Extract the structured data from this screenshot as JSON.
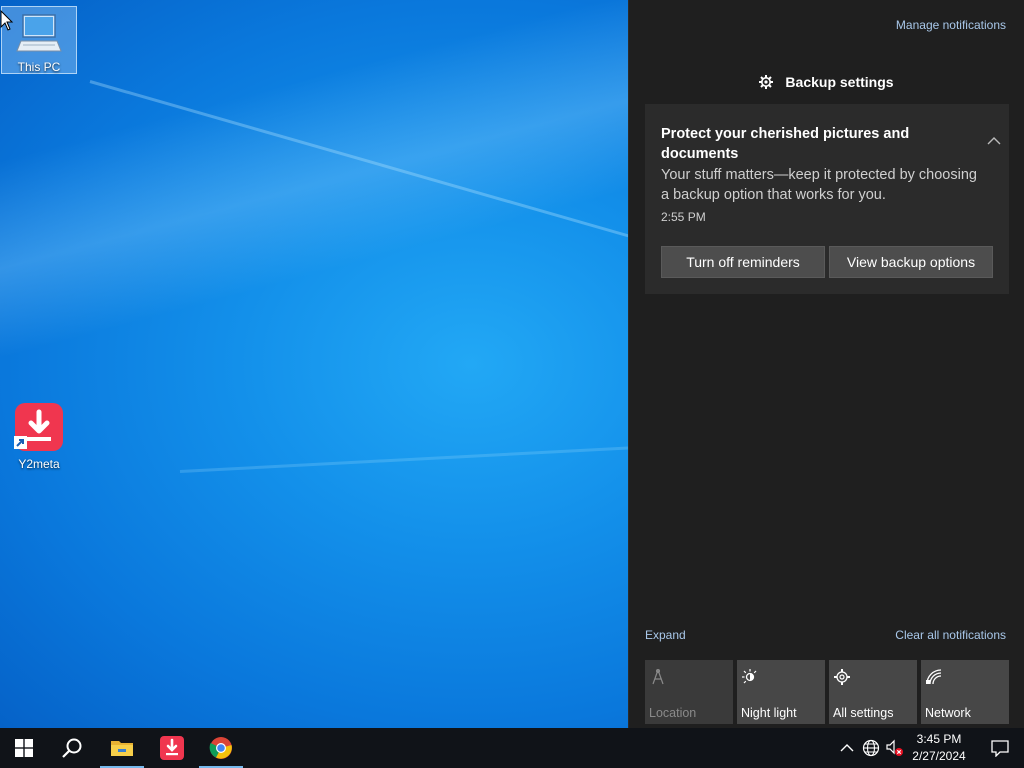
{
  "desktop": {
    "icons": [
      {
        "label": "This PC",
        "icon": "computer-icon"
      },
      {
        "label": "Y2meta",
        "icon": "y2meta-download-icon"
      }
    ]
  },
  "action_center": {
    "manage_notifications": "Manage notifications",
    "group_header": "Backup settings",
    "toast": {
      "title": "Protect your cherished pictures and documents",
      "body": "Your stuff matters—keep it protected by choosing a backup option that works for you.",
      "time": "2:55 PM",
      "buttons": [
        "Turn off reminders",
        "View backup options"
      ]
    },
    "expand": "Expand",
    "clear_all": "Clear all notifications",
    "quick_actions": [
      {
        "label": "Location",
        "icon": "location-icon",
        "enabled": false
      },
      {
        "label": "Night light",
        "icon": "night-light-icon",
        "enabled": true
      },
      {
        "label": "All settings",
        "icon": "gear-icon",
        "enabled": true
      },
      {
        "label": "Network",
        "icon": "network-icon",
        "enabled": true
      }
    ]
  },
  "taskbar": {
    "apps": [
      "start-icon",
      "search-icon",
      "file-explorer-icon",
      "y2meta-icon",
      "chrome-icon"
    ],
    "tray": [
      "chevron-up-icon",
      "globe-icon",
      "volume-muted-icon"
    ],
    "time": "3:45 PM",
    "date": "2/27/2024"
  },
  "colors": {
    "accent_link": "#a9c8ea",
    "action_center_bg": "#1f1f1f",
    "toast_bg": "#2b2b2b",
    "taskbar_bg": "#101318"
  }
}
